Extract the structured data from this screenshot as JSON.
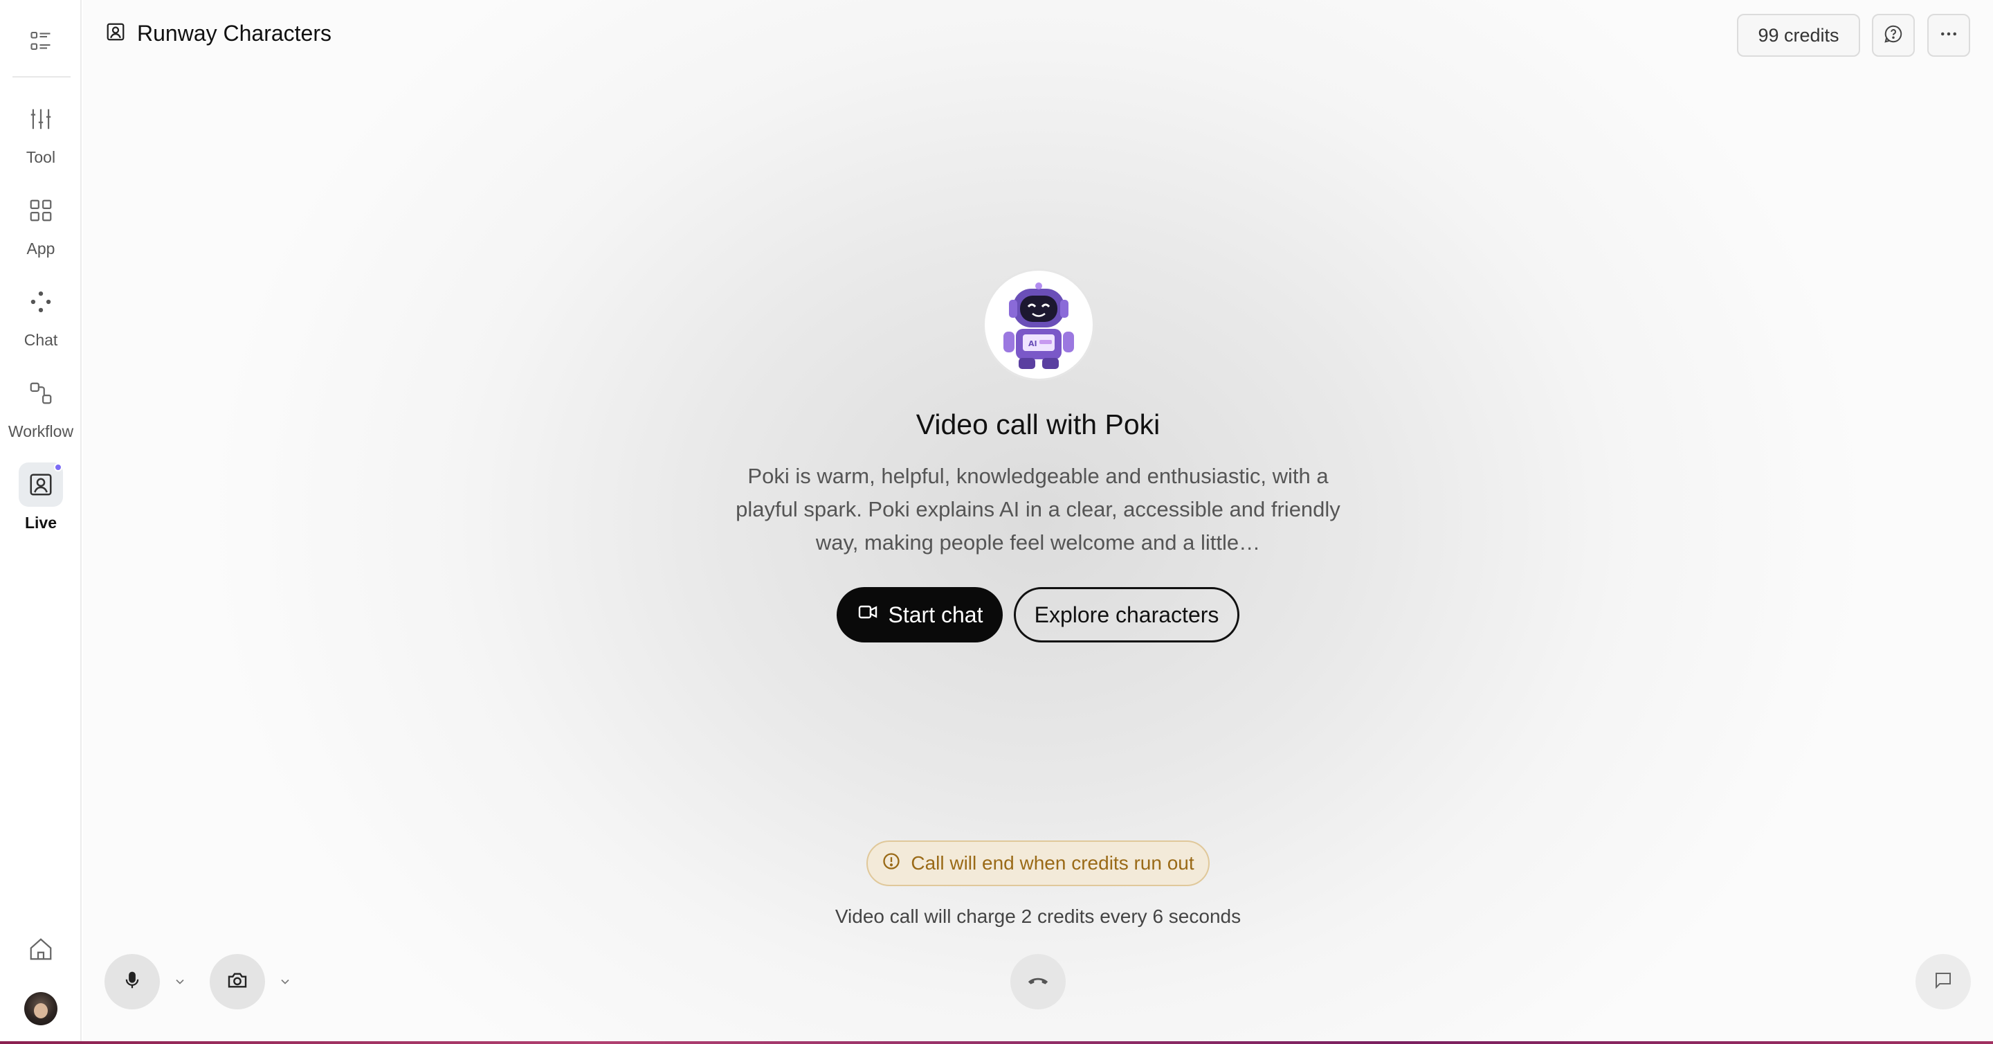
{
  "sidebar": {
    "items": [
      {
        "label": "Tool",
        "icon": "sliders-icon"
      },
      {
        "label": "App",
        "icon": "grid-icon"
      },
      {
        "label": "Chat",
        "icon": "chat-dots-icon"
      },
      {
        "label": "Workflow",
        "icon": "workflow-icon"
      },
      {
        "label": "Live",
        "icon": "live-portrait-icon",
        "active": true
      }
    ]
  },
  "header": {
    "title": "Runway Characters",
    "credits": "99 credits"
  },
  "character": {
    "heading": "Video call with Poki",
    "description": "Poki is warm, helpful, knowledgeable and enthusiastic, with a playful spark. Poki explains AI in a clear, accessible and friendly way, making people feel welcome and a little…"
  },
  "actions": {
    "start_label": "Start chat",
    "explore_label": "Explore characters"
  },
  "notice": {
    "warning": "Call will end when credits run out",
    "charge": "Video call will charge 2 credits every 6 seconds"
  },
  "colors": {
    "accent_dot": "#7c6cf5",
    "warning_bg": "#f3ead9",
    "warning_text": "#9a6a17"
  }
}
